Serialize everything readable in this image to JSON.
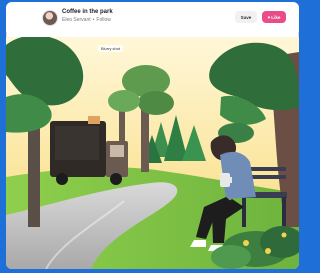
{
  "header": {
    "title": "Coffee in the park",
    "author": "Eleo Servant",
    "separator": "•",
    "follow": "Follow",
    "save_label": "Save",
    "like_label": "Like"
  },
  "shot": {
    "tag": "Blurry shot"
  },
  "colors": {
    "accent_like": "#ea4c89",
    "frame_blue": "#1f6fd8"
  },
  "icons": {
    "like": "heart-icon"
  }
}
